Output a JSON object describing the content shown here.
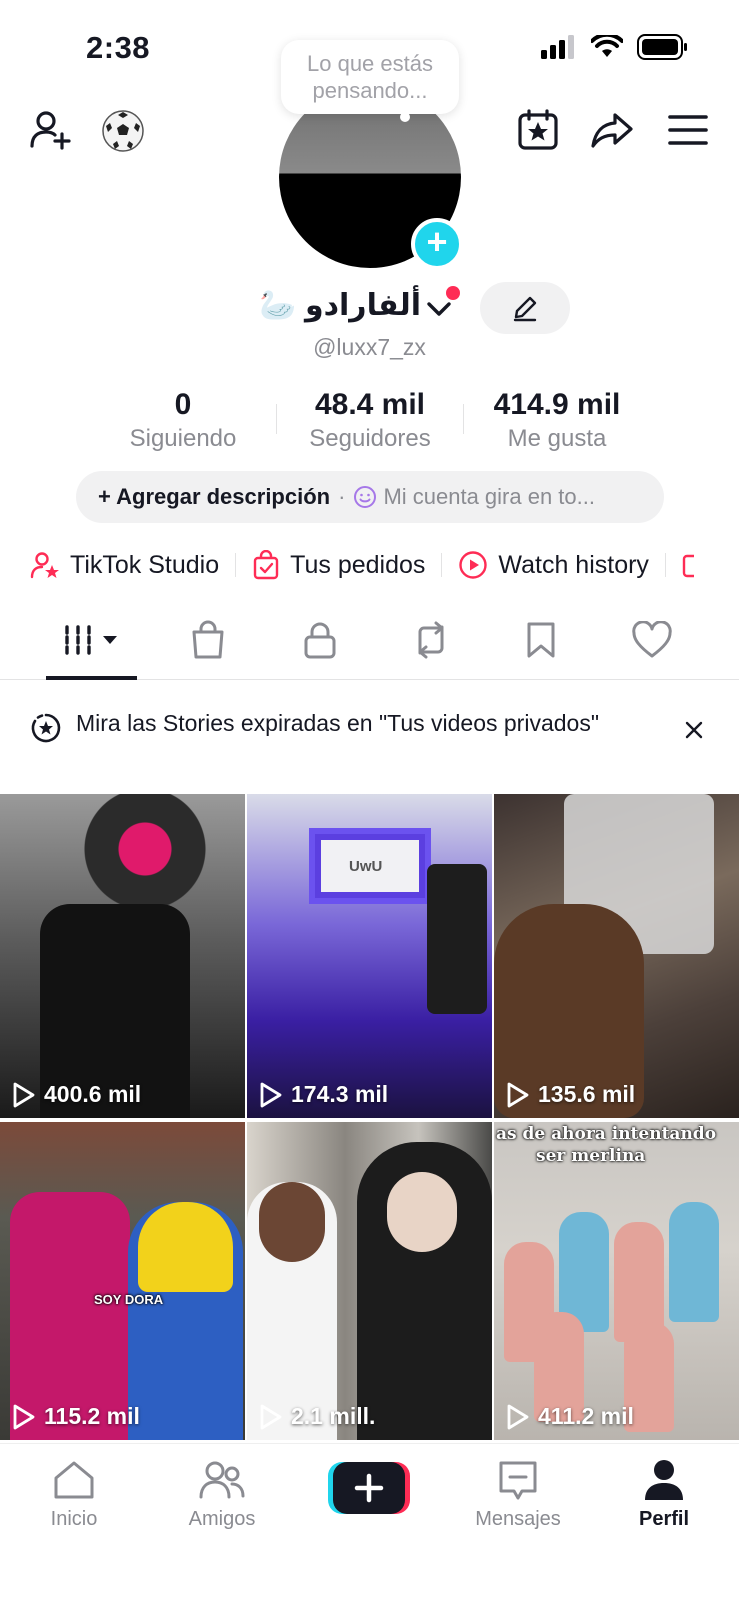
{
  "status": {
    "time": "2:38"
  },
  "bubble": {
    "text_line1": "Lo que estás",
    "text_line2": "pensando..."
  },
  "profile": {
    "name": "ألفارادو 🦢",
    "handle": "@luxx7_zx"
  },
  "stats": [
    {
      "value": "0",
      "label": "Siguiendo"
    },
    {
      "value": "48.4 mil",
      "label": "Seguidores"
    },
    {
      "value": "414.9 mil",
      "label": "Me gusta"
    }
  ],
  "description": {
    "add_label": "+ Agregar descripción",
    "dot": "·",
    "hint": "Mi cuenta gira en to..."
  },
  "tools": [
    {
      "label": "TikTok Studio",
      "icon": "person-star-icon"
    },
    {
      "label": "Tus pedidos",
      "icon": "bag-check-icon"
    },
    {
      "label": "Watch history",
      "icon": "play-circle-icon"
    }
  ],
  "banner": {
    "text": "Mira las Stories expiradas en \"Tus videos privados\""
  },
  "videos": [
    {
      "views": "400.6 mil"
    },
    {
      "views": "174.3 mil",
      "overlay": "UwU"
    },
    {
      "views": "135.6 mil"
    },
    {
      "views": "115.2 mil",
      "overlay": "SOY DORA"
    },
    {
      "views": "2.1 mill."
    },
    {
      "views": "411.2 mil",
      "overlay_line1": "as de ahora intentando",
      "overlay_line2": "ser merlina"
    }
  ],
  "nav": [
    {
      "label": "Inicio",
      "icon": "home-icon"
    },
    {
      "label": "Amigos",
      "icon": "friends-icon"
    },
    {
      "label": "",
      "icon": "create-plus-icon"
    },
    {
      "label": "Mensajes",
      "icon": "message-icon"
    },
    {
      "label": "Perfil",
      "icon": "profile-icon"
    }
  ],
  "colors": {
    "accent_red": "#fe2c55",
    "accent_cyan": "#20d5ec",
    "text": "#161823",
    "muted": "#8a8b91"
  }
}
